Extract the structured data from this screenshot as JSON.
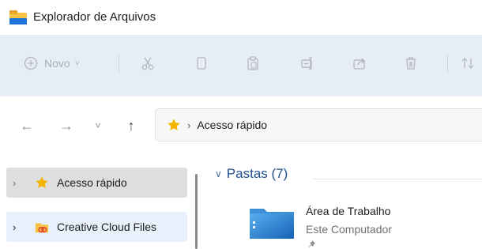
{
  "window": {
    "title": "Explorador de Arquivos"
  },
  "ribbon": {
    "new_label": "Novo",
    "new_caret": "˅",
    "icons": [
      "plus-circle-icon",
      "cut-icon",
      "copy-icon",
      "paste-icon",
      "rename-icon",
      "share-icon",
      "delete-icon",
      "sort-icon"
    ]
  },
  "navigation": {
    "back": "←",
    "forward": "→",
    "recent": "˅",
    "up": "↑"
  },
  "address_bar": {
    "separator": "›",
    "location": "Acesso rápido"
  },
  "sidebar": {
    "items": [
      {
        "chevron": "›",
        "label": "Acesso rápido",
        "icon": "star-icon",
        "state": "selected"
      },
      {
        "chevron": "›",
        "label": "Creative Cloud Files",
        "icon": "creative-cloud-icon",
        "state": "hover"
      }
    ]
  },
  "content": {
    "group": {
      "chevron": "∨",
      "title": "Pastas (7)"
    },
    "items": [
      {
        "name": "Área de Trabalho",
        "location": "Este Computador",
        "pinned": true,
        "icon": "desktop-folder-icon"
      }
    ]
  },
  "colors": {
    "ribbon_bg": "#e7edf5",
    "accent": "#1f4f8f",
    "star": "#f4b400",
    "selected_bg": "#dedede",
    "hover_bg": "#e8f1fb"
  }
}
